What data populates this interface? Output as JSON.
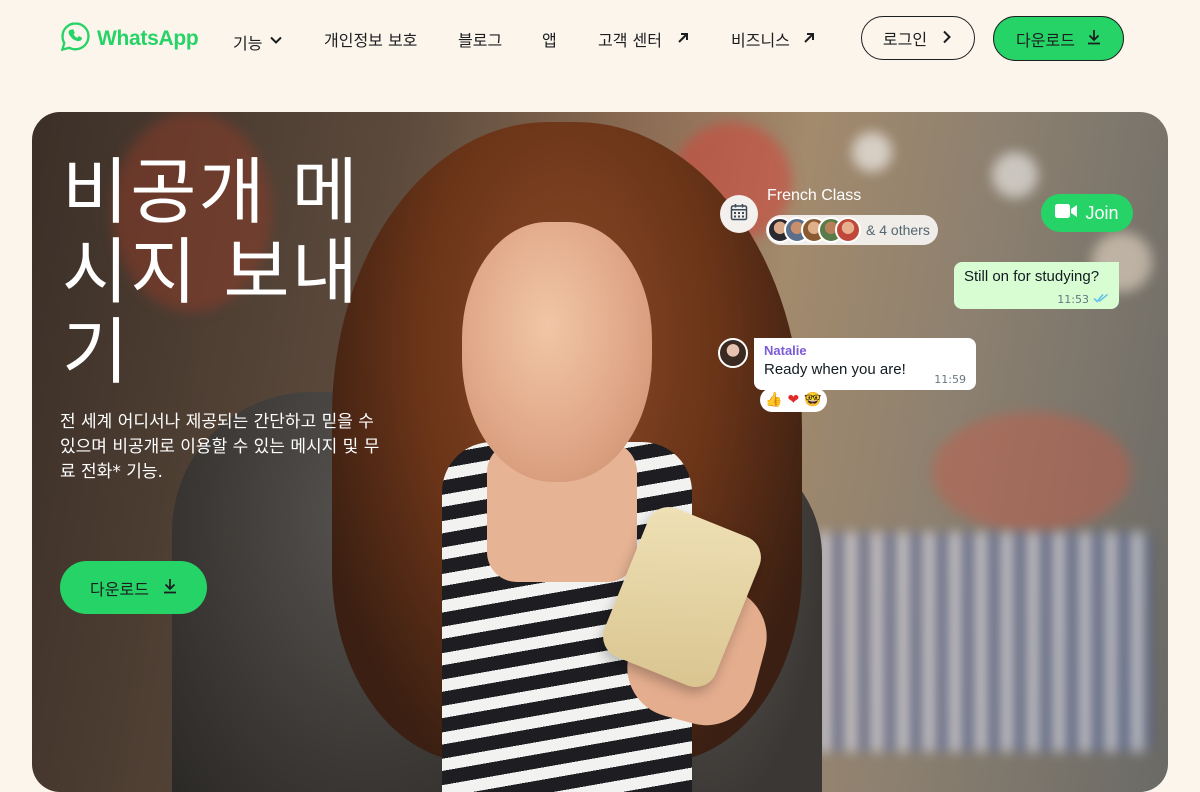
{
  "nav": {
    "logo_text": "WhatsApp",
    "items": [
      {
        "label": "기능",
        "icon": "chevron-down-icon"
      },
      {
        "label": "개인정보 보호"
      },
      {
        "label": "블로그"
      },
      {
        "label": "앱"
      },
      {
        "label": "고객 센터",
        "icon": "external-arrow-icon"
      },
      {
        "label": "비즈니스",
        "icon": "external-arrow-icon"
      }
    ],
    "login_label": "로그인",
    "download_label": "다운로드"
  },
  "hero": {
    "title": "비공개 메시지 보내기",
    "subtitle": "전 세계 어디서나 제공되는 간단하고 믿을 수 있으며 비공개로 이용할 수 있는 메시지 및 무료 전화* 기능.",
    "download_label": "다운로드"
  },
  "chat": {
    "group_name": "French Class",
    "others_label": "& 4 others",
    "join_label": "Join",
    "outgoing": {
      "text": "Still on for studying?",
      "time": "11:53"
    },
    "incoming": {
      "sender": "Natalie",
      "text": "Ready when you are!",
      "time": "11:59"
    },
    "reactions": [
      "👍",
      "❤",
      "🤓"
    ]
  },
  "colors": {
    "brand_green": "#25d366",
    "page_bg": "#fcf5eb",
    "outgoing_bubble": "#d9fdd3",
    "sender_name": "#7b5bd6"
  }
}
